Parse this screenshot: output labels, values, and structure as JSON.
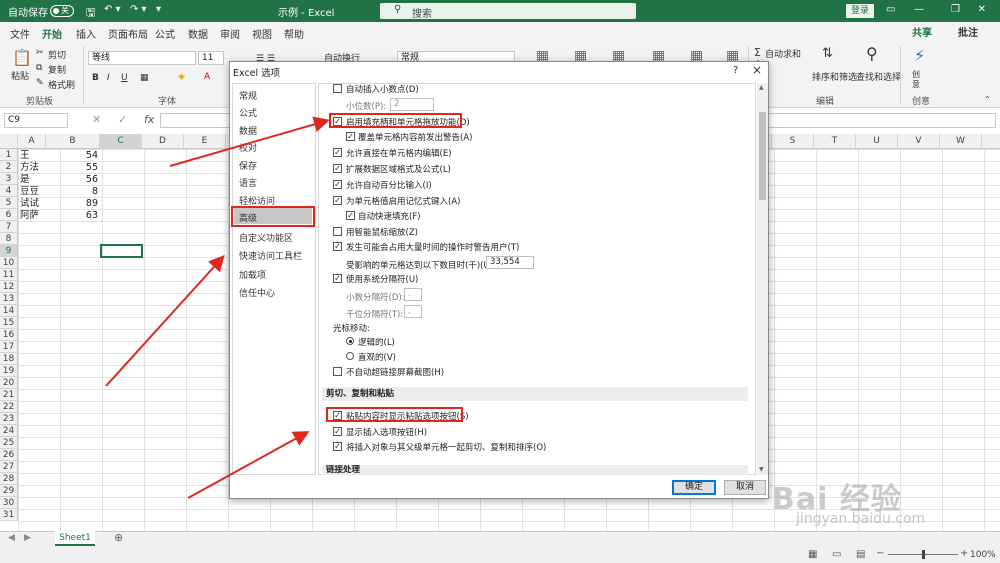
{
  "titlebar": {
    "autosave_label": "自动保存",
    "autosave_state": "关",
    "doc_title": "示例 - Excel",
    "search_placeholder": "搜索",
    "signin_label": "登录"
  },
  "menu": {
    "items": [
      "文件",
      "开始",
      "插入",
      "页面布局",
      "公式",
      "数据",
      "审阅",
      "视图",
      "帮助"
    ],
    "active": "开始",
    "share_label": "共享",
    "comment_label": "批注"
  },
  "ribbon": {
    "clipboard": {
      "paste": "粘贴",
      "cut": "剪切",
      "copy": "复制",
      "format_painter": "格式刷",
      "group": "剪贴板"
    },
    "font": {
      "name": "等线",
      "size": "11",
      "group": "字体"
    },
    "wrap_text": "自动换行",
    "number_format": "常规",
    "editing": {
      "autosum": "自动求和",
      "sort_filter": "排序和筛选",
      "find_select": "查找和选择",
      "group": "编辑"
    },
    "create": {
      "label": "创意",
      "group": "创意"
    }
  },
  "formula_bar": {
    "name_box": "C9",
    "fx": "fx",
    "value": ""
  },
  "sheet": {
    "columns": [
      "A",
      "B",
      "C",
      "D",
      "E",
      "F",
      "G",
      "H",
      "I",
      "J",
      "K",
      "L",
      "M",
      "N",
      "O",
      "P",
      "Q",
      "R",
      "S",
      "T",
      "U",
      "V",
      "W"
    ],
    "row_numbers": [
      "1",
      "2",
      "3",
      "4",
      "5",
      "6",
      "7",
      "8",
      "9",
      "10",
      "11",
      "12",
      "13",
      "14",
      "15",
      "16",
      "17",
      "18",
      "19",
      "20",
      "21",
      "22",
      "23",
      "24",
      "25",
      "26",
      "27",
      "28",
      "29",
      "30",
      "31",
      "32"
    ],
    "data": [
      {
        "a": "王",
        "b": "54"
      },
      {
        "a": "方法",
        "b": "55"
      },
      {
        "a": "是",
        "b": "56"
      },
      {
        "a": "豆豆",
        "b": "8"
      },
      {
        "a": "试试",
        "b": "89"
      },
      {
        "a": "阿萨",
        "b": "63"
      }
    ],
    "tab_name": "Sheet1",
    "zoom": "100%"
  },
  "dialog": {
    "title": "Excel 选项",
    "help": "?",
    "close": "×",
    "nav": [
      "常规",
      "公式",
      "数据",
      "校对",
      "保存",
      "语言",
      "轻松访问",
      "高级",
      "自定义功能区",
      "快速访问工具栏",
      "加载项",
      "信任中心"
    ],
    "selected_nav": "高级",
    "options": {
      "auto_decimal": "自动插入小数点(D)",
      "decimal_places_label": "小位数(P):",
      "decimal_places_value": "2",
      "fill_handle": "启用填充柄和单元格拖放功能(D)",
      "overwrite_alert": "覆盖单元格内容前发出警告(A)",
      "edit_in_cell": "允许直接在单元格内编辑(E)",
      "extend_formats": "扩展数据区域格式及公式(L)",
      "auto_percent": "允许自动百分比输入(I)",
      "autocomplete": "为单元格值启用记忆式键入(A)",
      "flash_fill": "自动快速填充(F)",
      "intellimouse_zoom": "用智能鼠标缩放(Z)",
      "long_op_alert": "发生可能会占用大量时间的操作时警告用户(T)",
      "cells_affected_label": "受影响的单元格达到以下数目时(千)(U):",
      "cells_affected_value": "33,554",
      "system_separators": "使用系统分隔符(U)",
      "decimal_sep_label": "小数分隔符(D):",
      "decimal_sep_value": ".",
      "thousands_sep_label": "千位分隔符(T):",
      "thousands_sep_value": ",",
      "cursor_move_label": "光标移动:",
      "cursor_logical": "逻辑的(L)",
      "cursor_visual": "直观的(V)",
      "no_hyperlink_screenshot": "不自动超链接屏幕截图(H)",
      "section_cut_copy_paste": "剪切、复制和粘贴",
      "paste_options_button": "粘贴内容时显示粘贴选项按钮(S)",
      "insert_options_button": "显示插入选项按钮(H)",
      "sort_with_parent": "将插入对象与其父级单元格一起剪切、复制和排序(O)",
      "section_link": "链接处理"
    },
    "ok_label": "确定",
    "cancel_label": "取消"
  },
  "watermark": {
    "brand": "Bai 经验",
    "url": "jingyan.baidu.com"
  },
  "colors": {
    "excel_green": "#217346",
    "annotation_red": "#e0271f"
  }
}
